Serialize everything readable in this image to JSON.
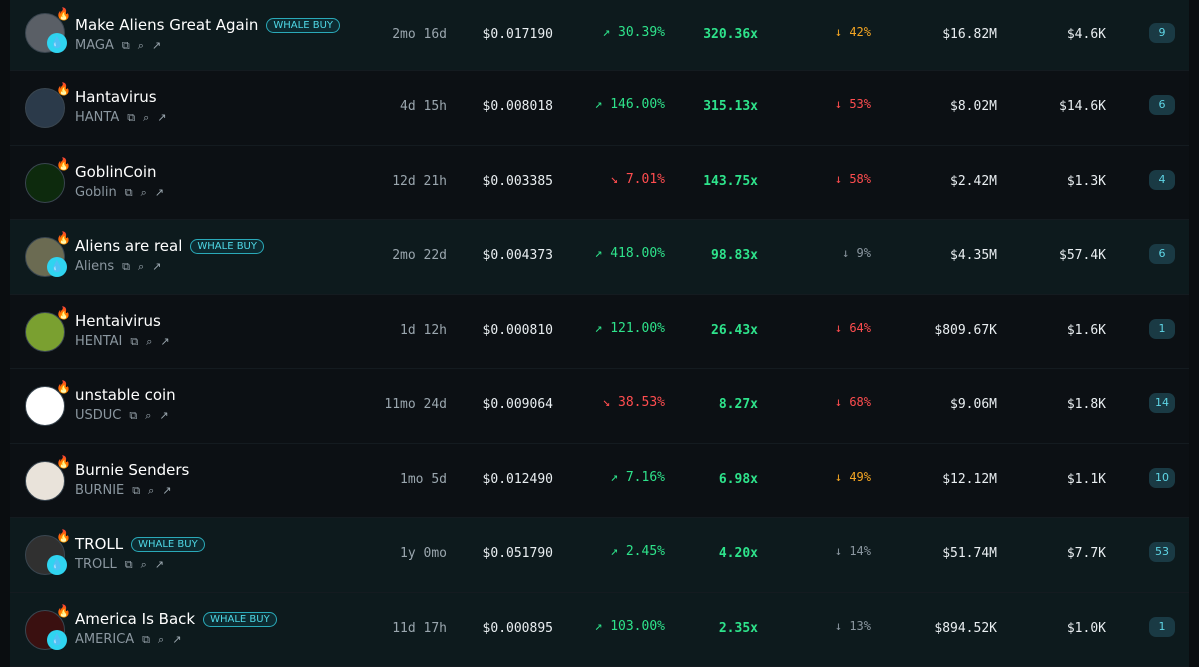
{
  "tokens": [
    {
      "name": "Make Aliens Great Again",
      "whale": true,
      "ticker": "MAGA",
      "age": "2mo 16d",
      "price": "$0.017190",
      "change": "30.39%",
      "dir": "up",
      "multiple": "320.36x",
      "ath": "42%",
      "ath_color": "orange",
      "mcap": "$16.82M",
      "volume": "$4.6K",
      "count": "9"
    },
    {
      "name": "Hantavirus",
      "whale": false,
      "ticker": "HANTA",
      "age": "4d 15h",
      "price": "$0.008018",
      "change": "146.00%",
      "dir": "up",
      "multiple": "315.13x",
      "ath": "53%",
      "ath_color": "red",
      "mcap": "$8.02M",
      "volume": "$14.6K",
      "count": "6"
    },
    {
      "name": "GoblinCoin",
      "whale": false,
      "ticker": "Goblin",
      "age": "12d 21h",
      "price": "$0.003385",
      "change": "7.01%",
      "dir": "down",
      "multiple": "143.75x",
      "ath": "58%",
      "ath_color": "red",
      "mcap": "$2.42M",
      "volume": "$1.3K",
      "count": "4"
    },
    {
      "name": "Aliens are real",
      "whale": true,
      "ticker": "Aliens",
      "age": "2mo 22d",
      "price": "$0.004373",
      "change": "418.00%",
      "dir": "up",
      "multiple": "98.83x",
      "ath": "9%",
      "ath_color": "grey",
      "mcap": "$4.35M",
      "volume": "$57.4K",
      "count": "6"
    },
    {
      "name": "Hentaivirus",
      "whale": false,
      "ticker": "HENTAI",
      "age": "1d 12h",
      "price": "$0.000810",
      "change": "121.00%",
      "dir": "up",
      "multiple": "26.43x",
      "ath": "64%",
      "ath_color": "red",
      "mcap": "$809.67K",
      "volume": "$1.6K",
      "count": "1"
    },
    {
      "name": "unstable coin",
      "whale": false,
      "ticker": "USDUC",
      "age": "11mo 24d",
      "price": "$0.009064",
      "change": "38.53%",
      "dir": "down",
      "multiple": "8.27x",
      "ath": "68%",
      "ath_color": "red",
      "mcap": "$9.06M",
      "volume": "$1.8K",
      "count": "14"
    },
    {
      "name": "Burnie Senders",
      "whale": false,
      "ticker": "BURNIE",
      "age": "1mo 5d",
      "price": "$0.012490",
      "change": "7.16%",
      "dir": "up",
      "multiple": "6.98x",
      "ath": "49%",
      "ath_color": "orange",
      "mcap": "$12.12M",
      "volume": "$1.1K",
      "count": "10"
    },
    {
      "name": "TROLL",
      "whale": true,
      "ticker": "TROLL",
      "age": "1y 0mo",
      "price": "$0.051790",
      "change": "2.45%",
      "dir": "up",
      "multiple": "4.20x",
      "ath": "14%",
      "ath_color": "grey",
      "mcap": "$51.74M",
      "volume": "$7.7K",
      "count": "53"
    },
    {
      "name": "America Is Back",
      "whale": true,
      "ticker": "AMERICA",
      "age": "11d 17h",
      "price": "$0.000895",
      "change": "103.00%",
      "dir": "up",
      "multiple": "2.35x",
      "ath": "13%",
      "ath_color": "grey",
      "mcap": "$894.52K",
      "volume": "$1.0K",
      "count": "1"
    }
  ],
  "labels": {
    "whale_badge": "WHALE BUY"
  },
  "icons": {
    "copy": "copy-icon",
    "search": "search-icon",
    "external": "external-link-icon",
    "fire": "fire-icon",
    "trend_up": "trend-up-icon",
    "trend_down": "trend-down-icon",
    "arrow_down": "arrow-down-icon"
  },
  "colors": {
    "up": "#2ee38b",
    "down": "#ff4d4f",
    "orange": "#f5a623",
    "grey": "#8b97a0",
    "accent": "#2fd4f0"
  }
}
